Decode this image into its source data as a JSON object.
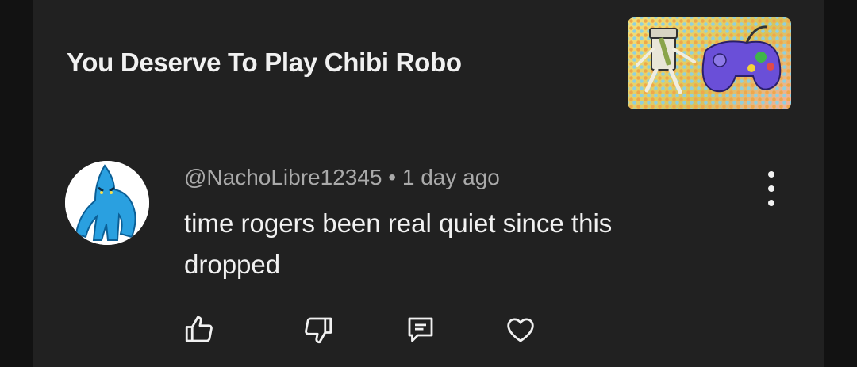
{
  "video": {
    "title": "You Deserve To Play Chibi Robo"
  },
  "comment": {
    "author": "@NachoLibre12345",
    "separator": "•",
    "time": "1 day ago",
    "text": "time rogers been real quiet since this dropped"
  },
  "actions": {
    "like_icon": "thumbs-up-icon",
    "dislike_icon": "thumbs-down-icon",
    "reply_icon": "comment-icon",
    "heart_icon": "heart-icon",
    "more_icon": "more-vertical-icon"
  },
  "colors": {
    "panel": "#212121",
    "text": "#f1f1f1",
    "secondary_text": "#aaaaaa"
  }
}
